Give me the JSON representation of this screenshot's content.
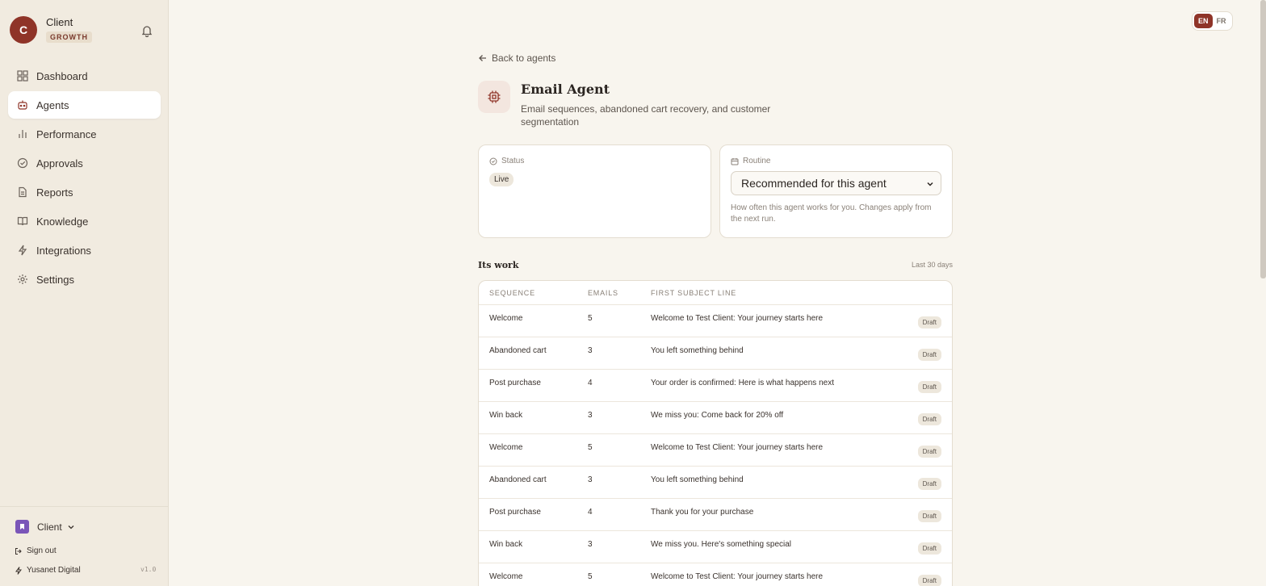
{
  "sidebar": {
    "brand": {
      "initial": "C",
      "name": "Client",
      "plan": "GROWTH"
    },
    "nav": [
      {
        "label": "Dashboard",
        "icon": "grid-icon"
      },
      {
        "label": "Agents",
        "icon": "bot-icon",
        "active": true
      },
      {
        "label": "Performance",
        "icon": "bar-chart-icon"
      },
      {
        "label": "Approvals",
        "icon": "check-circle-icon"
      },
      {
        "label": "Reports",
        "icon": "document-icon"
      },
      {
        "label": "Knowledge",
        "icon": "book-icon"
      },
      {
        "label": "Integrations",
        "icon": "lightning-icon"
      },
      {
        "label": "Settings",
        "icon": "gear-icon"
      }
    ],
    "footer": {
      "org_name": "Client",
      "sign_out": "Sign out",
      "company": "Yusanet Digital",
      "version": "v1.0"
    }
  },
  "lang": {
    "en": "EN",
    "fr": "FR",
    "active": "EN"
  },
  "main": {
    "back_label": "Back to agents",
    "agent_title": "Email Agent",
    "agent_desc": "Email sequences, abandoned cart recovery, and customer segmentation",
    "status": {
      "label": "Status",
      "value": "Live"
    },
    "routine": {
      "label": "Routine",
      "selected": "Recommended for this agent",
      "help": "How often this agent works for you. Changes apply from the next run."
    },
    "work": {
      "title": "Its work",
      "range": "Last 30 days",
      "columns": [
        "SEQUENCE",
        "EMAILS",
        "FIRST SUBJECT LINE"
      ],
      "rows": [
        {
          "sequence": "Welcome",
          "emails": "5",
          "subject": "Welcome to Test Client: Your journey starts here",
          "status": "Draft"
        },
        {
          "sequence": "Abandoned cart",
          "emails": "3",
          "subject": "You left something behind",
          "status": "Draft"
        },
        {
          "sequence": "Post purchase",
          "emails": "4",
          "subject": "Your order is confirmed: Here is what happens next",
          "status": "Draft"
        },
        {
          "sequence": "Win back",
          "emails": "3",
          "subject": "We miss you: Come back for 20% off",
          "status": "Draft"
        },
        {
          "sequence": "Welcome",
          "emails": "5",
          "subject": "Welcome to Test Client: Your journey starts here",
          "status": "Draft"
        },
        {
          "sequence": "Abandoned cart",
          "emails": "3",
          "subject": "You left something behind",
          "status": "Draft"
        },
        {
          "sequence": "Post purchase",
          "emails": "4",
          "subject": "Thank you for your purchase",
          "status": "Draft"
        },
        {
          "sequence": "Win back",
          "emails": "3",
          "subject": "We miss you. Here's something special",
          "status": "Draft"
        },
        {
          "sequence": "Welcome",
          "emails": "5",
          "subject": "Welcome to Test Client: Your journey starts here",
          "status": "Draft"
        }
      ]
    }
  },
  "colors": {
    "accent": "#8f3428",
    "background": "#f8f5ee",
    "sidebar": "#f1ebe0"
  }
}
